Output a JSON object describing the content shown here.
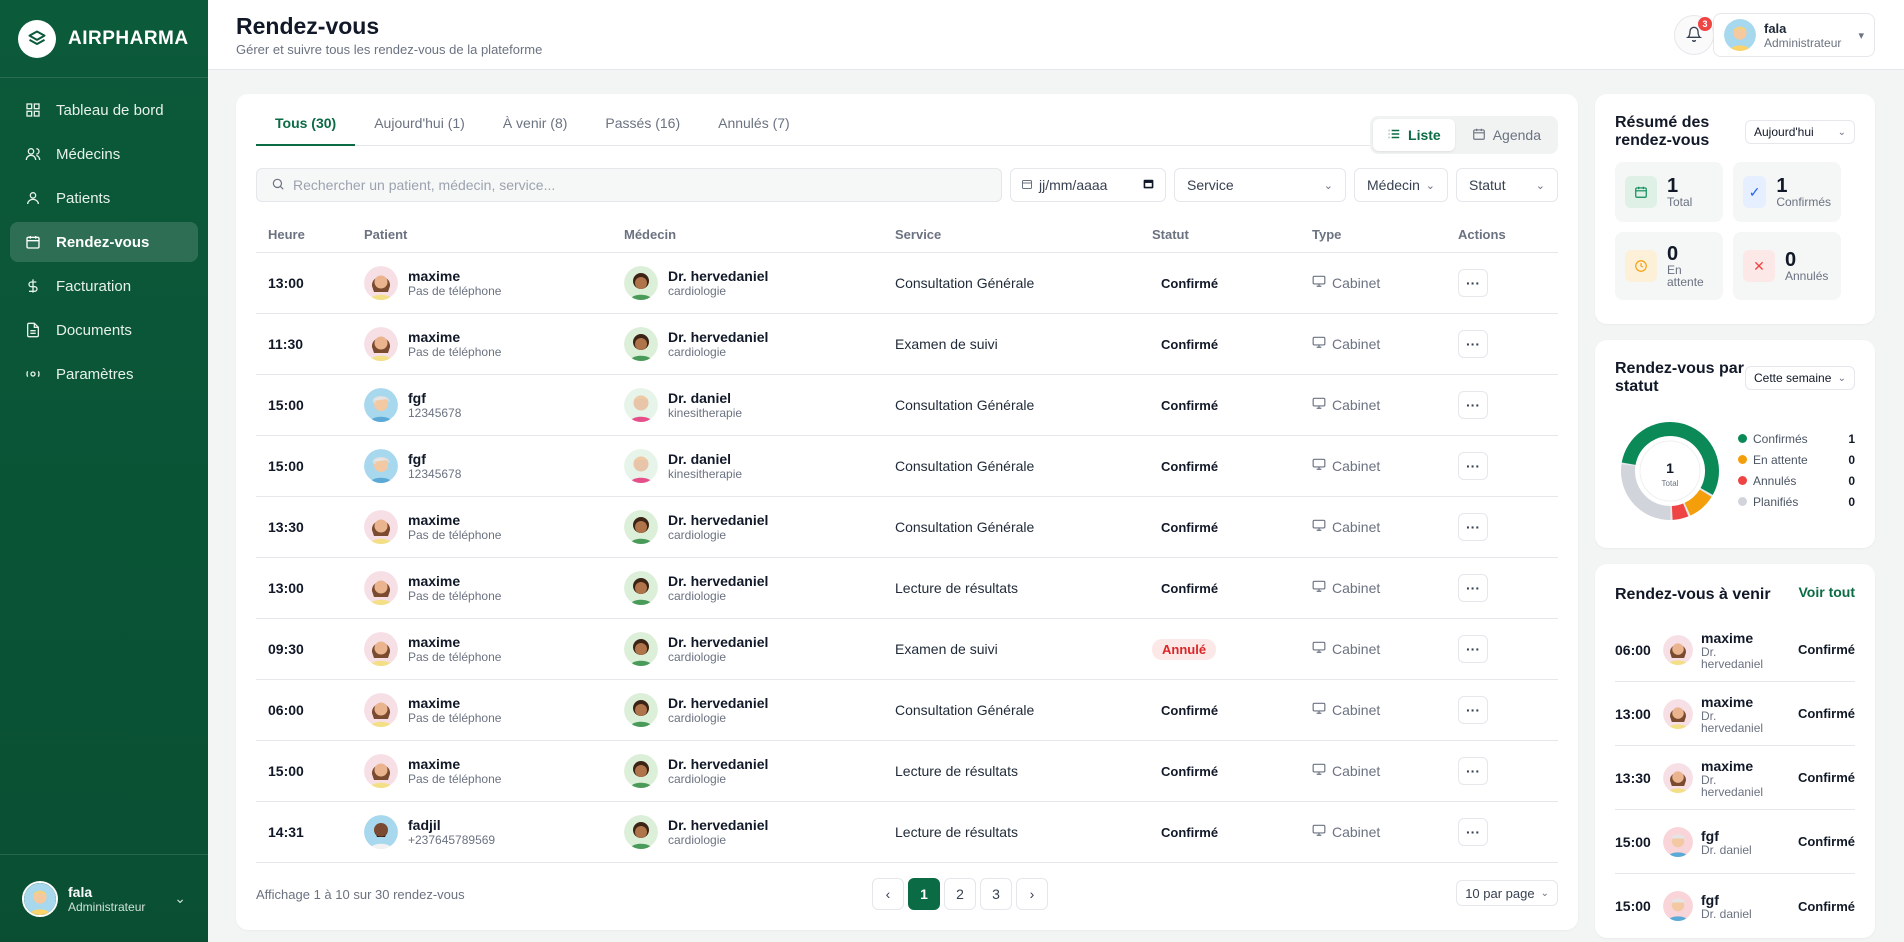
{
  "brand": {
    "name": "AIRPHARMA"
  },
  "sidebar": {
    "items": [
      {
        "label": "Tableau de bord",
        "icon": "dashboard-icon"
      },
      {
        "label": "Médecins",
        "icon": "doctors-icon"
      },
      {
        "label": "Patients",
        "icon": "patient-icon"
      },
      {
        "label": "Rendez-vous",
        "icon": "calendar-icon",
        "active": true
      },
      {
        "label": "Facturation",
        "icon": "dollar-icon"
      },
      {
        "label": "Documents",
        "icon": "document-icon"
      },
      {
        "label": "Paramètres",
        "icon": "settings-icon"
      }
    ],
    "user": {
      "name": "fala",
      "role": "Administrateur"
    }
  },
  "header": {
    "title": "Rendez-vous",
    "subtitle": "Gérer et suivre tous les rendez-vous de la plateforme",
    "notifications": "3",
    "user": {
      "name": "fala",
      "role": "Administrateur"
    }
  },
  "tabs": [
    {
      "label": "Tous (30)",
      "active": true
    },
    {
      "label": "Aujourd'hui (1)"
    },
    {
      "label": "À venir (8)"
    },
    {
      "label": "Passés (16)"
    },
    {
      "label": "Annulés (7)"
    }
  ],
  "view": {
    "list": "Liste",
    "agenda": "Agenda"
  },
  "filters": {
    "search_placeholder": "Rechercher un patient, médecin, service...",
    "date_placeholder": "jj/mm/aaaa",
    "service": "Service",
    "medecin": "Médecin",
    "statut": "Statut"
  },
  "table": {
    "columns": [
      "Heure",
      "Patient",
      "Médecin",
      "Service",
      "Statut",
      "Type",
      "Actions"
    ],
    "rows": [
      {
        "time": "13:00",
        "patient": "maxime",
        "patient_sub": "Pas de téléphone",
        "doctor": "Dr. hervedaniel",
        "doctor_sub": "cardiologie",
        "service": "Consultation Générale",
        "status": "Confirmé",
        "type": "Cabinet",
        "pav": "woman",
        "dav": "man"
      },
      {
        "time": "11:30",
        "patient": "maxime",
        "patient_sub": "Pas de téléphone",
        "doctor": "Dr. hervedaniel",
        "doctor_sub": "cardiologie",
        "service": "Examen de suivi",
        "status": "Confirmé",
        "type": "Cabinet",
        "pav": "woman",
        "dav": "man"
      },
      {
        "time": "15:00",
        "patient": "fgf",
        "patient_sub": "12345678",
        "doctor": "Dr. daniel",
        "doctor_sub": "kinesitherapie",
        "service": "Consultation Générale",
        "status": "Confirmé",
        "type": "Cabinet",
        "pav": "old",
        "dav": "pink"
      },
      {
        "time": "15:00",
        "patient": "fgf",
        "patient_sub": "12345678",
        "doctor": "Dr. daniel",
        "doctor_sub": "kinesitherapie",
        "service": "Consultation Générale",
        "status": "Confirmé",
        "type": "Cabinet",
        "pav": "old",
        "dav": "pink"
      },
      {
        "time": "13:30",
        "patient": "maxime",
        "patient_sub": "Pas de téléphone",
        "doctor": "Dr. hervedaniel",
        "doctor_sub": "cardiologie",
        "service": "Consultation Générale",
        "status": "Confirmé",
        "type": "Cabinet",
        "pav": "woman",
        "dav": "man"
      },
      {
        "time": "13:00",
        "patient": "maxime",
        "patient_sub": "Pas de téléphone",
        "doctor": "Dr. hervedaniel",
        "doctor_sub": "cardiologie",
        "service": "Lecture de résultats",
        "status": "Confirmé",
        "type": "Cabinet",
        "pav": "woman",
        "dav": "man"
      },
      {
        "time": "09:30",
        "patient": "maxime",
        "patient_sub": "Pas de téléphone",
        "doctor": "Dr. hervedaniel",
        "doctor_sub": "cardiologie",
        "service": "Examen de suivi",
        "status": "Annulé",
        "type": "Cabinet",
        "pav": "woman",
        "dav": "man"
      },
      {
        "time": "06:00",
        "patient": "maxime",
        "patient_sub": "Pas de téléphone",
        "doctor": "Dr. hervedaniel",
        "doctor_sub": "cardiologie",
        "service": "Consultation Générale",
        "status": "Confirmé",
        "type": "Cabinet",
        "pav": "woman",
        "dav": "man"
      },
      {
        "time": "15:00",
        "patient": "maxime",
        "patient_sub": "Pas de téléphone",
        "doctor": "Dr. hervedaniel",
        "doctor_sub": "cardiologie",
        "service": "Lecture de résultats",
        "status": "Confirmé",
        "type": "Cabinet",
        "pav": "woman",
        "dav": "man"
      },
      {
        "time": "14:31",
        "patient": "fadjil",
        "patient_sub": "+237645789569",
        "doctor": "Dr. hervedaniel",
        "doctor_sub": "cardiologie",
        "service": "Lecture de résultats",
        "status": "Confirmé",
        "type": "Cabinet",
        "pav": "beard",
        "dav": "man"
      }
    ]
  },
  "pagination": {
    "summary": "Affichage 1 à 10 sur 30 rendez-vous",
    "prev": "‹",
    "next": "›",
    "pages": [
      "1",
      "2",
      "3"
    ],
    "per_page": "10 par page"
  },
  "summary": {
    "title": "Résumé des rendez-vous",
    "period": "Aujourd'hui",
    "stats": [
      {
        "value": "1",
        "label": "Total",
        "icon": "calendar-icon"
      },
      {
        "value": "1",
        "label": "Confirmés",
        "icon": "check-icon"
      },
      {
        "value": "0",
        "label": "En attente",
        "icon": "clock-icon"
      },
      {
        "value": "0",
        "label": "Annulés",
        "icon": "x-icon"
      }
    ]
  },
  "status_chart": {
    "title": "Rendez-vous par statut",
    "period": "Cette semaine",
    "center_value": "1",
    "center_label": "Total",
    "legend": [
      {
        "label": "Confirmés",
        "value": "1",
        "color": "#0b8a57"
      },
      {
        "label": "En attente",
        "value": "0",
        "color": "#f59e0b"
      },
      {
        "label": "Annulés",
        "value": "0",
        "color": "#ef4444"
      },
      {
        "label": "Planifiés",
        "value": "0",
        "color": "#d1d5db"
      }
    ]
  },
  "chart_data": {
    "type": "pie",
    "categories": [
      "Confirmés",
      "En attente",
      "Annulés",
      "Planifiés"
    ],
    "values": [
      1,
      0,
      0,
      0
    ],
    "title": "Rendez-vous par statut"
  },
  "upcoming": {
    "title": "Rendez-vous à venir",
    "see_all": "Voir tout",
    "items": [
      {
        "time": "06:00",
        "name": "maxime",
        "doctor": "Dr. hervedaniel",
        "status": "Confirmé",
        "av": "woman"
      },
      {
        "time": "13:00",
        "name": "maxime",
        "doctor": "Dr. hervedaniel",
        "status": "Confirmé",
        "av": "woman"
      },
      {
        "time": "13:30",
        "name": "maxime",
        "doctor": "Dr. hervedaniel",
        "status": "Confirmé",
        "av": "woman"
      },
      {
        "time": "15:00",
        "name": "fgf",
        "doctor": "Dr. daniel",
        "status": "Confirmé",
        "av": "oldpink"
      },
      {
        "time": "15:00",
        "name": "fgf",
        "doctor": "Dr. daniel",
        "status": "Confirmé",
        "av": "oldpink"
      }
    ]
  },
  "colors": {
    "brand": "#0b6b45",
    "sidebar": "#0b5a3a",
    "danger": "#dc2626"
  }
}
